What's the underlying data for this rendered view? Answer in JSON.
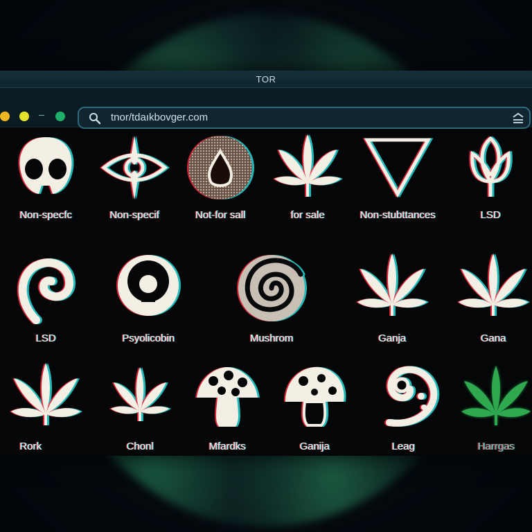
{
  "window": {
    "title": "TOR"
  },
  "toolbar": {
    "dash": "–",
    "url": "tnor/tdaıkbovger.com"
  },
  "colors": {
    "dot_red": "#f1b51e",
    "dot_yellow": "#e6e12a",
    "dot_green": "#1fae6a",
    "accent_cyan": "#2e6a7a",
    "glitch_red": "#ff2840",
    "glitch_cyan": "#28e6e6",
    "leaf_green": "#2fa84f"
  },
  "grid": {
    "items": [
      {
        "label": "Non-specfc",
        "icon": "skull-icon"
      },
      {
        "label": "Non-specif",
        "icon": "eye-icon"
      },
      {
        "label": "Not-for sall",
        "icon": "drop-circle-icon"
      },
      {
        "label": "for sale",
        "icon": "leaf-icon"
      },
      {
        "label": "Non-stubttances",
        "icon": "triangle-icon"
      },
      {
        "label": "LSD",
        "icon": "tulip-icon"
      },
      {
        "label": "LSD",
        "icon": "spiral-hook-icon"
      },
      {
        "label": "Psyolicobin",
        "icon": "circle-keyhole-icon"
      },
      {
        "label": "Mushrom",
        "icon": "vortex-icon"
      },
      {
        "label": "Ganja",
        "icon": "leaf-icon"
      },
      {
        "label": "Gana",
        "icon": "leaf-icon"
      },
      {
        "label": "Rork",
        "icon": "leaf-icon"
      },
      {
        "label": "Chonl",
        "icon": "leaf-icon"
      },
      {
        "label": "Mfardks",
        "icon": "mushroom-icon"
      },
      {
        "label": "Ganija",
        "icon": "mushroom-spotted-icon"
      },
      {
        "label": "Leag",
        "icon": "swirl-moon-icon"
      },
      {
        "label": "Harrgas",
        "icon": "leaf-green-icon"
      }
    ]
  }
}
